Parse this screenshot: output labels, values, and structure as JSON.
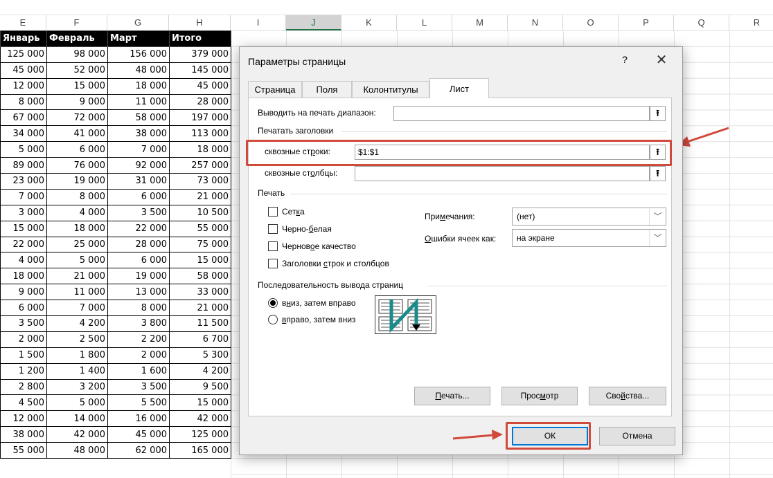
{
  "columns": [
    "E",
    "F",
    "G",
    "H",
    "I",
    "J",
    "K",
    "L",
    "M",
    "N",
    "O",
    "P",
    "Q",
    "R"
  ],
  "selected_column": "J",
  "table": {
    "headers": [
      "Январь",
      "Февраль",
      "Март",
      "Итого"
    ],
    "rows": [
      [
        "125 000",
        "98 000",
        "156 000",
        "379 000"
      ],
      [
        "45 000",
        "52 000",
        "48 000",
        "145 000"
      ],
      [
        "12 000",
        "15 000",
        "18 000",
        "45 000"
      ],
      [
        "8 000",
        "9 000",
        "11 000",
        "28 000"
      ],
      [
        "67 000",
        "72 000",
        "58 000",
        "197 000"
      ],
      [
        "34 000",
        "41 000",
        "38 000",
        "113 000"
      ],
      [
        "5 000",
        "6 000",
        "7 000",
        "18 000"
      ],
      [
        "89 000",
        "76 000",
        "92 000",
        "257 000"
      ],
      [
        "23 000",
        "19 000",
        "31 000",
        "73 000"
      ],
      [
        "7 000",
        "8 000",
        "6 000",
        "21 000"
      ],
      [
        "3 000",
        "4 000",
        "3 500",
        "10 500"
      ],
      [
        "15 000",
        "18 000",
        "22 000",
        "55 000"
      ],
      [
        "22 000",
        "25 000",
        "28 000",
        "75 000"
      ],
      [
        "4 000",
        "5 000",
        "6 000",
        "15 000"
      ],
      [
        "18 000",
        "21 000",
        "19 000",
        "58 000"
      ],
      [
        "9 000",
        "11 000",
        "13 000",
        "33 000"
      ],
      [
        "6 000",
        "7 000",
        "8 000",
        "21 000"
      ],
      [
        "3 500",
        "4 200",
        "3 800",
        "11 500"
      ],
      [
        "2 000",
        "2 500",
        "2 200",
        "6 700"
      ],
      [
        "1 500",
        "1 800",
        "2 000",
        "5 300"
      ],
      [
        "1 200",
        "1 400",
        "1 600",
        "4 200"
      ],
      [
        "2 800",
        "3 200",
        "3 500",
        "9 500"
      ],
      [
        "4 500",
        "5 000",
        "5 500",
        "15 000"
      ],
      [
        "12 000",
        "14 000",
        "16 000",
        "42 000"
      ],
      [
        "38 000",
        "42 000",
        "45 000",
        "125 000"
      ],
      [
        "55 000",
        "48 000",
        "62 000",
        "165 000"
      ]
    ]
  },
  "dialog": {
    "title": "Параметры страницы",
    "help": "?",
    "close": "✕",
    "tabs": [
      "Страница",
      "Поля",
      "Колонтитулы",
      "Лист"
    ],
    "active_tab": "Лист",
    "print_area": {
      "label_pre": "Выводить на печать ",
      "label_u": "д",
      "label_post": "иапазон:",
      "value": ""
    },
    "print_titles_heading": "Печатать заголовки",
    "rows_repeat": {
      "label_pre": "сквозные ст",
      "label_u": "р",
      "label_post": "оки:",
      "value": "$1:$1"
    },
    "cols_repeat": {
      "label_pre": "сквозные ст",
      "label_u": "о",
      "label_post": "лбцы:",
      "value": ""
    },
    "print_heading": "Печать",
    "checkboxes": [
      {
        "pre": "Сет",
        "u": "к",
        "post": "а"
      },
      {
        "pre": "Черно-",
        "u": "б",
        "post": "елая"
      },
      {
        "pre": "Чернов",
        "u": "о",
        "post": "е качество"
      },
      {
        "pre": "Заголовки ",
        "u": "с",
        "post": "трок и столбцов"
      }
    ],
    "comments": {
      "label_pre": "При",
      "label_u": "м",
      "label_post": "ечания:",
      "value": "(нет)"
    },
    "errors": {
      "label_pre": "",
      "label_u": "О",
      "label_post": "шибки ячеек как:",
      "value": "на экране"
    },
    "order_heading": "Последовательность вывода страниц",
    "order_options": [
      {
        "pre": "в",
        "u": "н",
        "post": "из, затем вправо",
        "selected": true
      },
      {
        "pre": "",
        "u": "в",
        "post": "право, затем вниз",
        "selected": false
      }
    ],
    "buttons": {
      "print": {
        "u": "П",
        "post": "ечать..."
      },
      "preview": {
        "pre": "Прос",
        "u": "м",
        "post": "отр"
      },
      "properties": {
        "pre": "Сво",
        "u": "й",
        "post": "ства..."
      },
      "ok": "ОК",
      "cancel": "Отмена"
    }
  },
  "colors": {
    "accent": "#0078d7",
    "highlight": "#d04a3c",
    "excel_green": "#217346",
    "order_arrow": "#1a8a8a"
  }
}
